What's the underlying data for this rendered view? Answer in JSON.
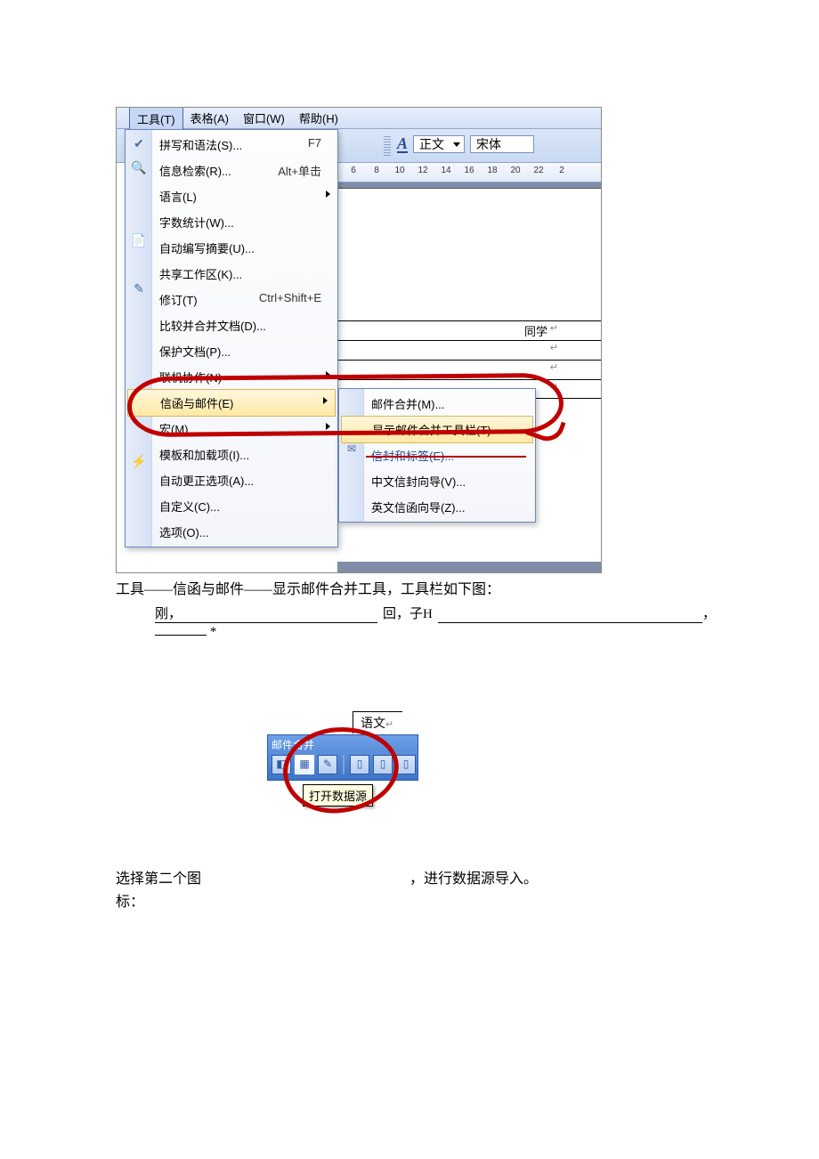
{
  "menubar": {
    "tools": "工具(T)",
    "table": "表格(A)",
    "window": "窗口(W)",
    "help": "帮助(H)"
  },
  "toolbar": {
    "style_label": "正文",
    "font_label": "宋体"
  },
  "ruler": {
    "ticks": [
      "6",
      "8",
      "10",
      "12",
      "14",
      "16",
      "18",
      "20",
      "22",
      "2"
    ]
  },
  "doc_table": {
    "label1": "同学"
  },
  "tools_menu": {
    "spelling": "拼写和语法(S)...",
    "spelling_sc": "F7",
    "research": "信息检索(R)...",
    "research_sc": "Alt+单击",
    "language": "语言(L)",
    "wordcount": "字数统计(W)...",
    "autosummary": "自动编写摘要(U)...",
    "shared": "共享工作区(K)...",
    "track": "修订(T)",
    "track_sc": "Ctrl+Shift+E",
    "compare": "比较并合并文档(D)...",
    "protect": "保护文档(P)...",
    "online": "联机协作(N)",
    "letters": "信函与邮件(E)",
    "macro": "宏(M)",
    "templates": "模板和加载项(I)...",
    "autocorrect": "自动更正选项(A)...",
    "customize": "自定义(C)...",
    "options": "选项(O)..."
  },
  "letters_submenu": {
    "mailmerge": "邮件合并(M)...",
    "show_toolbar": "显示邮件合并工具栏(T)",
    "envelopes": "信封和标签(E)...",
    "cn_wizard": "中文信封向导(V)...",
    "en_wizard": "英文信函向导(Z)..."
  },
  "caption1": "工具——信函与邮件——显示邮件合并工具，工具栏如下图：",
  "fill": {
    "a": "刚，",
    "b": "回，子H",
    "c": "，",
    "d": "*"
  },
  "shot2": {
    "cell": "语文",
    "bar_title": "邮件合并",
    "tooltip": "打开数据源"
  },
  "bottom": {
    "left_a": "选择第二个图",
    "left_b": "标：",
    "right": "，进行数据源导入。"
  }
}
